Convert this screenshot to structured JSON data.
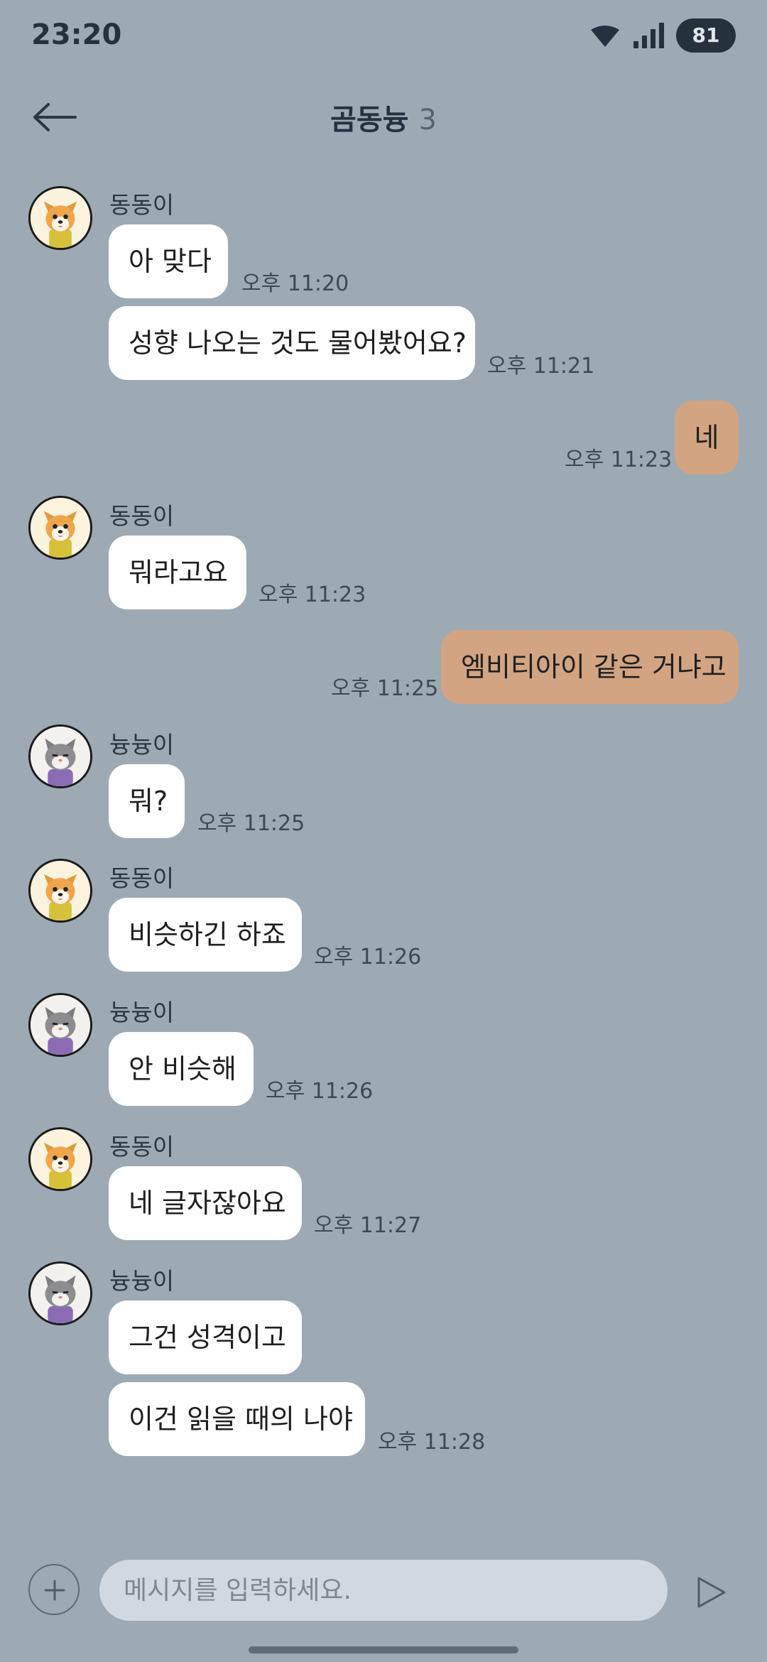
{
  "status": {
    "time": "23:20",
    "battery": "81"
  },
  "header": {
    "title": "곰동늉",
    "count": "3"
  },
  "messages": [
    {
      "sender": "동동이",
      "text": "아 맞다",
      "time": "오후 11:20"
    },
    {
      "text": "성향 나오는 것도 물어봤어요?",
      "time": "오후 11:21"
    },
    {
      "text": "네",
      "time": "오후 11:23"
    },
    {
      "sender": "동동이",
      "text": "뭐라고요",
      "time": "오후 11:23"
    },
    {
      "text": "엠비티아이 같은 거냐고",
      "time": "오후 11:25"
    },
    {
      "sender": "늉늉이",
      "text": "뭐?",
      "time": "오후 11:25"
    },
    {
      "sender": "동동이",
      "text": "비슷하긴 하죠",
      "time": "오후 11:26"
    },
    {
      "sender": "늉늉이",
      "text": "안 비슷해",
      "time": "오후 11:26"
    },
    {
      "sender": "동동이",
      "text": "네 글자잖아요",
      "time": "오후 11:27"
    },
    {
      "sender": "늉늉이",
      "text": "그건 성격이고"
    },
    {
      "text": "이건 읽을 때의 나야",
      "time": "오후 11:28"
    }
  ],
  "input": {
    "placeholder": "메시지를 입력하세요."
  },
  "icons": {
    "back": "arrow-left-icon",
    "plus": "plus-icon",
    "send": "send-icon",
    "dog": "dog-avatar",
    "cat": "cat-avatar"
  },
  "colors": {
    "background": "#9daab4",
    "incoming": "#ffffff",
    "outgoing": "#d2a482"
  }
}
